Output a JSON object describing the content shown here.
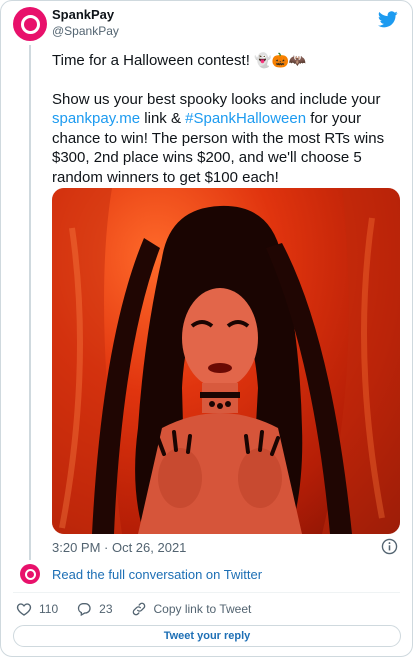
{
  "author": {
    "name": "SpankPay",
    "handle": "@SpankPay",
    "avatar_color": "#e8116b"
  },
  "brand_icon": "twitter-bird-icon",
  "tweet": {
    "line1": "Time for a Halloween contest!",
    "line1_emoji": [
      "ghost",
      "jack-o-lantern",
      "bat"
    ],
    "para2_before_link": "Show us your best spooky looks and include your",
    "link_url_text": "spankpay.me",
    "para2_mid": "link &",
    "hashtag": "#SpankHalloween",
    "para2_after": "for your chance to win! The person with the most RTs wins $300, 2nd place wins $200, and we'll choose 5 random winners to get $100 each!"
  },
  "timestamp": "3:20 PM · Oct 26, 2021",
  "read_full": "Read the full conversation on Twitter",
  "actions": {
    "likes": "110",
    "replies": "23",
    "copy_link": "Copy link to Tweet"
  },
  "reply_button": "Tweet your reply",
  "colors": {
    "link": "#1d9bf0",
    "muted": "#536471",
    "border": "#cfd9de",
    "twitter_blue": "#1d9bf0",
    "like_red": "#f91880"
  }
}
